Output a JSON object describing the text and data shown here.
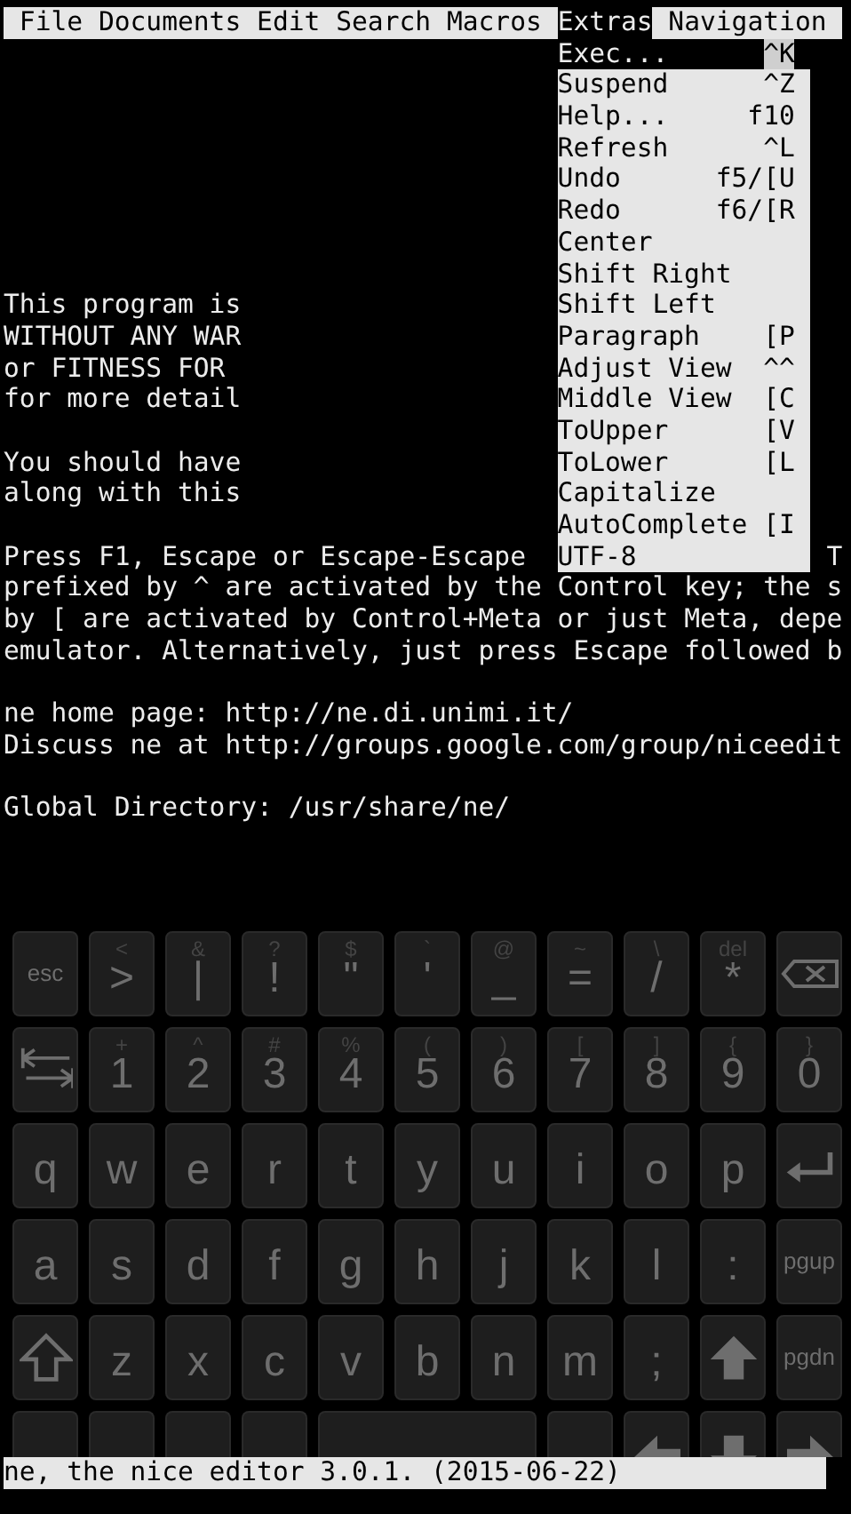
{
  "menu_bar": [
    {
      "label": "File",
      "selected": false
    },
    {
      "label": "Documents",
      "selected": false
    },
    {
      "label": "Edit",
      "selected": false
    },
    {
      "label": "Search",
      "selected": false
    },
    {
      "label": "Macros",
      "selected": false
    },
    {
      "label": "Extras",
      "selected": true
    },
    {
      "label": "Navigation",
      "selected": false
    }
  ],
  "menu": [
    {
      "label": "Exec...",
      "shortcut": "^K",
      "selected": true
    },
    {
      "label": "Suspend",
      "shortcut": "^Z",
      "selected": false
    },
    {
      "label": "Help...",
      "shortcut": "f10",
      "selected": false
    },
    {
      "label": "Refresh",
      "shortcut": "^L",
      "selected": false
    },
    {
      "label": "Undo",
      "shortcut": "f5/[U",
      "selected": false
    },
    {
      "label": "Redo",
      "shortcut": "f6/[R",
      "selected": false
    },
    {
      "label": "Center",
      "selected": false
    },
    {
      "label": "Shift Right",
      "selected": false
    },
    {
      "label": "Shift Left",
      "selected": false
    },
    {
      "label": "Paragraph",
      "shortcut": "[P",
      "selected": false
    },
    {
      "label": "Adjust View",
      "shortcut": "^^",
      "selected": false
    },
    {
      "label": "Middle View",
      "shortcut": "[C",
      "selected": false
    },
    {
      "label": "ToUpper",
      "shortcut": "[V",
      "selected": false
    },
    {
      "label": "ToLower",
      "shortcut": "[L",
      "selected": false
    },
    {
      "label": "Capitalize",
      "selected": false
    },
    {
      "label": "AutoComplete",
      "shortcut": "[I",
      "selected": false
    },
    {
      "label": "UTF-8",
      "selected": false
    }
  ],
  "paragraphs": [
    [
      {
        "text": "This program is"
      },
      {
        "text": "WITHOUT ANY WAR"
      },
      {
        "text": "or FITNESS FOR"
      },
      {
        "text": "for more detail"
      }
    ],
    [
      {
        "text": "You should have"
      },
      {
        "text": "along with this"
      }
    ],
    [
      {
        "text": "Press F1, Escape or Escape-Escape",
        "after_menu": "T"
      },
      {
        "text": "prefixed by ^ are activated by the Control key; the s"
      },
      {
        "text": "by [ are activated by Control+Meta or just Meta, depe"
      },
      {
        "text": "emulator. Alternatively, just press Escape followed b"
      }
    ],
    [
      {
        "text": "ne home page: http://ne.di.unimi.it/"
      },
      {
        "text": "Discuss ne at http://groups.google.com/group/niceedit"
      }
    ],
    [
      {
        "text": "Global Directory: /usr/share/ne/"
      }
    ]
  ],
  "status_bar": "ne, the nice editor 3.0.1. (2015-06-22)",
  "keyboard": [
    [
      {
        "kind": "esc",
        "label": "esc"
      },
      {
        "kind": "char",
        "label": ">",
        "alt": "<"
      },
      {
        "kind": "char",
        "label": "|",
        "alt": "&"
      },
      {
        "kind": "char",
        "label": "!",
        "alt": "?"
      },
      {
        "kind": "char",
        "label": "\"",
        "alt": "$"
      },
      {
        "kind": "char",
        "label": "'",
        "alt": "`"
      },
      {
        "kind": "char",
        "label": "_",
        "alt": "@"
      },
      {
        "kind": "char",
        "label": "=",
        "alt": "~"
      },
      {
        "kind": "char",
        "label": "/",
        "alt": "\\"
      },
      {
        "kind": "char",
        "label": "*",
        "alt": "del"
      },
      {
        "kind": "backspace"
      }
    ],
    [
      {
        "kind": "tab"
      },
      {
        "kind": "char",
        "label": "1",
        "alt": "+"
      },
      {
        "kind": "char",
        "label": "2",
        "alt": "^"
      },
      {
        "kind": "char",
        "label": "3",
        "alt": "#"
      },
      {
        "kind": "char",
        "label": "4",
        "alt": "%"
      },
      {
        "kind": "char",
        "label": "5",
        "alt": "("
      },
      {
        "kind": "char",
        "label": "6",
        "alt": ")"
      },
      {
        "kind": "char",
        "label": "7",
        "alt": "["
      },
      {
        "kind": "char",
        "label": "8",
        "alt": "]"
      },
      {
        "kind": "char",
        "label": "9",
        "alt": "{"
      },
      {
        "kind": "char",
        "label": "0",
        "alt": "}"
      }
    ],
    [
      {
        "kind": "char",
        "label": "q"
      },
      {
        "kind": "char",
        "label": "w"
      },
      {
        "kind": "char",
        "label": "e"
      },
      {
        "kind": "char",
        "label": "r"
      },
      {
        "kind": "char",
        "label": "t"
      },
      {
        "kind": "char",
        "label": "y"
      },
      {
        "kind": "char",
        "label": "u"
      },
      {
        "kind": "char",
        "label": "i"
      },
      {
        "kind": "char",
        "label": "o"
      },
      {
        "kind": "char",
        "label": "p"
      },
      {
        "kind": "enter"
      }
    ],
    [
      {
        "kind": "char",
        "label": "a"
      },
      {
        "kind": "char",
        "label": "s"
      },
      {
        "kind": "char",
        "label": "d"
      },
      {
        "kind": "char",
        "label": "f"
      },
      {
        "kind": "char",
        "label": "g"
      },
      {
        "kind": "char",
        "label": "h"
      },
      {
        "kind": "char",
        "label": "j"
      },
      {
        "kind": "char",
        "label": "k"
      },
      {
        "kind": "char",
        "label": "l"
      },
      {
        "kind": "char",
        "label": ":"
      },
      {
        "kind": "esc",
        "label": "pgup"
      }
    ],
    [
      {
        "kind": "shift"
      },
      {
        "kind": "char",
        "label": "z"
      },
      {
        "kind": "char",
        "label": "x"
      },
      {
        "kind": "char",
        "label": "c"
      },
      {
        "kind": "char",
        "label": "v"
      },
      {
        "kind": "char",
        "label": "b"
      },
      {
        "kind": "char",
        "label": "n"
      },
      {
        "kind": "char",
        "label": "m"
      },
      {
        "kind": "char",
        "label": ";"
      },
      {
        "kind": "up"
      },
      {
        "kind": "esc",
        "label": "pgdn"
      }
    ],
    [
      {
        "kind": "blank"
      },
      {
        "kind": "blank"
      },
      {
        "kind": "blank"
      },
      {
        "kind": "blank"
      },
      {
        "kind": "space"
      },
      {
        "kind": "blank"
      },
      {
        "kind": "left"
      },
      {
        "kind": "down"
      },
      {
        "kind": "right"
      }
    ]
  ]
}
